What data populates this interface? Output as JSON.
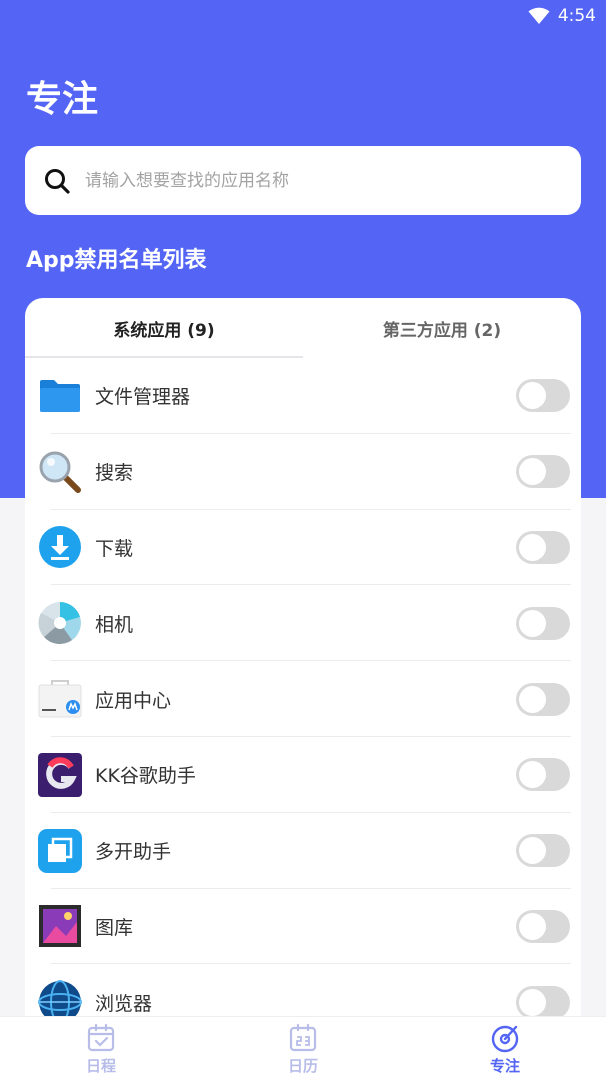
{
  "status_bar": {
    "time": "4:54",
    "wifi_icon": "wifi-icon"
  },
  "header": {
    "title": "专注"
  },
  "search": {
    "placeholder": "请输入想要查找的应用名称",
    "icon": "search-icon"
  },
  "section_title": "App禁用名单列表",
  "tabs": [
    {
      "label": "系统应用 (9)",
      "active": true
    },
    {
      "label": "第三方应用 (2)",
      "active": false
    }
  ],
  "apps": [
    {
      "name": "文件管理器",
      "icon": "folder-icon",
      "enabled": false
    },
    {
      "name": "搜索",
      "icon": "magnifier-icon",
      "enabled": false
    },
    {
      "name": "下载",
      "icon": "download-icon",
      "enabled": false
    },
    {
      "name": "相机",
      "icon": "camera-icon",
      "enabled": false
    },
    {
      "name": "应用中心",
      "icon": "app-center-icon",
      "enabled": false
    },
    {
      "name": "KK谷歌助手",
      "icon": "kk-google-icon",
      "enabled": false
    },
    {
      "name": "多开助手",
      "icon": "multi-open-icon",
      "enabled": false
    },
    {
      "name": "图库",
      "icon": "gallery-icon",
      "enabled": false
    },
    {
      "name": "浏览器",
      "icon": "browser-icon",
      "enabled": false
    }
  ],
  "bottom_nav": [
    {
      "label": "日程",
      "icon": "schedule-icon",
      "active": false
    },
    {
      "label": "日历",
      "icon": "calendar-icon",
      "active": false
    },
    {
      "label": "专注",
      "icon": "focus-icon",
      "active": true
    }
  ],
  "colors": {
    "primary": "#5465f6",
    "nav_inactive": "#b7bde8",
    "toggle_off": "#d9d9d9"
  }
}
